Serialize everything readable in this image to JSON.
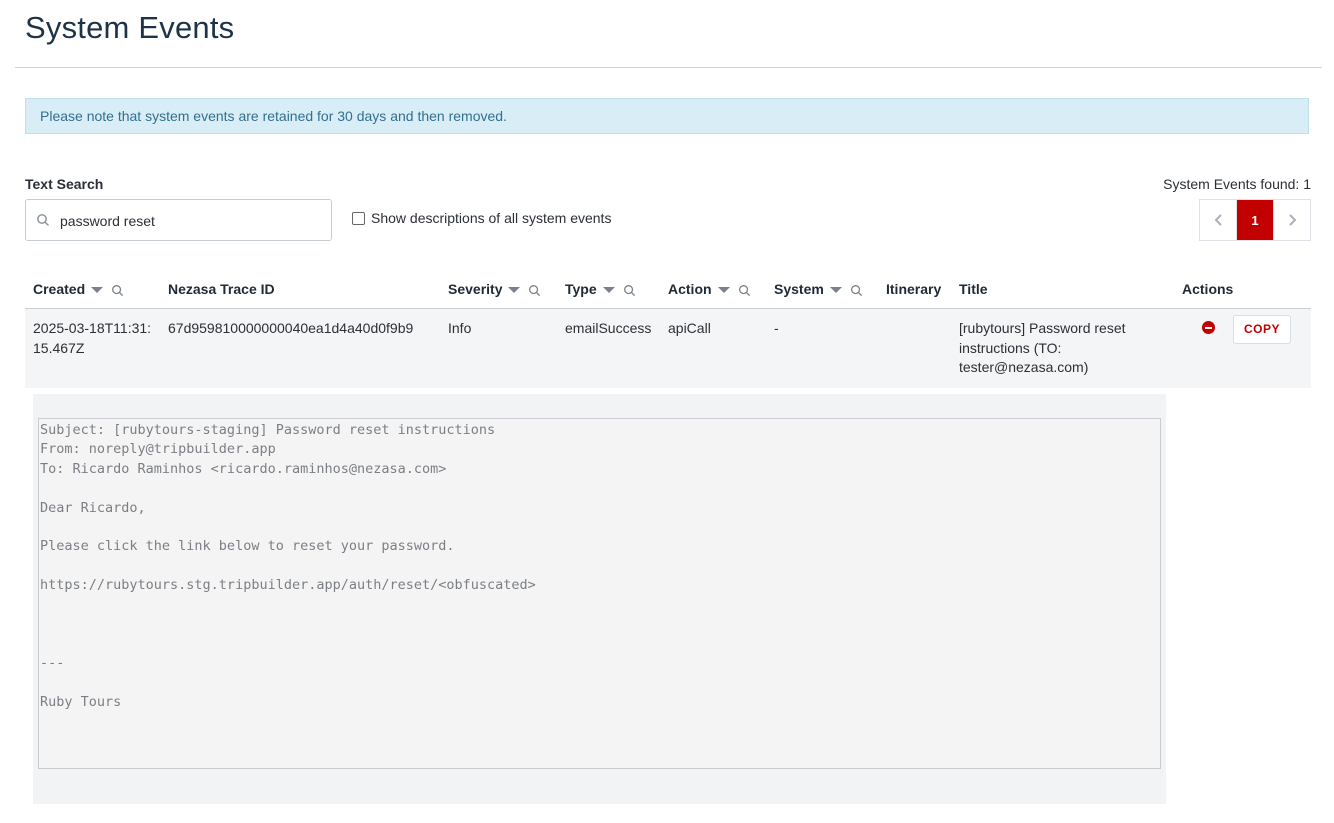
{
  "page": {
    "title": "System Events"
  },
  "notice": "Please note that system events are retained for 30 days and then removed.",
  "search": {
    "label": "Text Search",
    "value": "password reset",
    "placeholder": ""
  },
  "show_descriptions_label": "Show descriptions of all system events",
  "results": {
    "found_text": "System Events found: 1",
    "pagination": {
      "current": "1",
      "prev_icon": "chevron-left",
      "next_icon": "chevron-right"
    }
  },
  "table": {
    "columns": [
      "Created",
      "Nezasa Trace ID",
      "Severity",
      "Type",
      "Action",
      "System",
      "Itinerary",
      "Title",
      "Actions"
    ],
    "rows": [
      {
        "created": "2025-03-18T11:31:15.467Z",
        "trace_id": "67d959810000000040ea1d4a40d0f9b9",
        "severity": "Info",
        "type": "emailSuccess",
        "action": "apiCall",
        "system": "-",
        "itinerary": "",
        "title": "[rubytours] Password reset instructions (TO: tester@nezasa.com)",
        "copy_label": "COPY"
      }
    ]
  },
  "detail": {
    "text": "Subject: [rubytours-staging] Password reset instructions\nFrom: noreply@tripbuilder.app\nTo: Ricardo Raminhos <ricardo.raminhos@nezasa.com>\n\nDear Ricardo,\n\nPlease click the link below to reset your password.\n\nhttps://rubytours.stg.tripbuilder.app/auth/reset/<obfuscated>\n\n\n\n---\n\nRuby Tours"
  },
  "colors": {
    "accent": "#c20000",
    "notice_bg": "#d9edf7",
    "notice_text": "#31708f"
  }
}
